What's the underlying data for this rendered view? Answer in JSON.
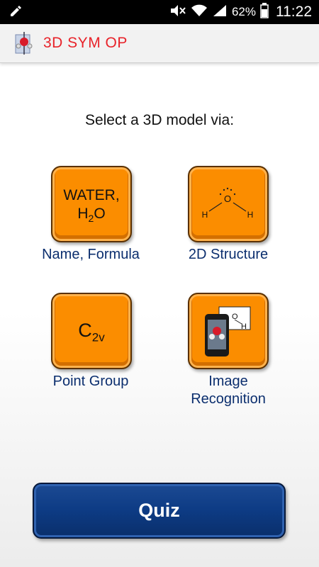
{
  "status_bar": {
    "battery_percent": "62%",
    "time": "11:22"
  },
  "app_bar": {
    "title": "3D SYM OP"
  },
  "prompt": "Select a 3D model via:",
  "options": [
    {
      "id": "name",
      "tile_line1": "WATER,",
      "tile_formula": "H",
      "tile_sub": "2",
      "tile_formula_end": "O",
      "caption": "Name, Formula"
    },
    {
      "id": "structure",
      "tile_atom_center": "O",
      "tile_atom_left": "H",
      "tile_atom_right": "H",
      "caption": "2D Structure"
    },
    {
      "id": "pointgroup",
      "tile_symbol": "C",
      "tile_sub": "2v",
      "caption": "Point Group"
    },
    {
      "id": "image",
      "tile_atom_o": "O",
      "tile_atom_h": "H",
      "caption_line1": "Image",
      "caption_line2": "Recognition"
    }
  ],
  "quiz_label": "Quiz",
  "colors": {
    "tile_orange": "#fb8d00",
    "caption_blue": "#0b2e6e",
    "title_red": "#e8232a",
    "quiz_blue": "#0d3b84"
  }
}
